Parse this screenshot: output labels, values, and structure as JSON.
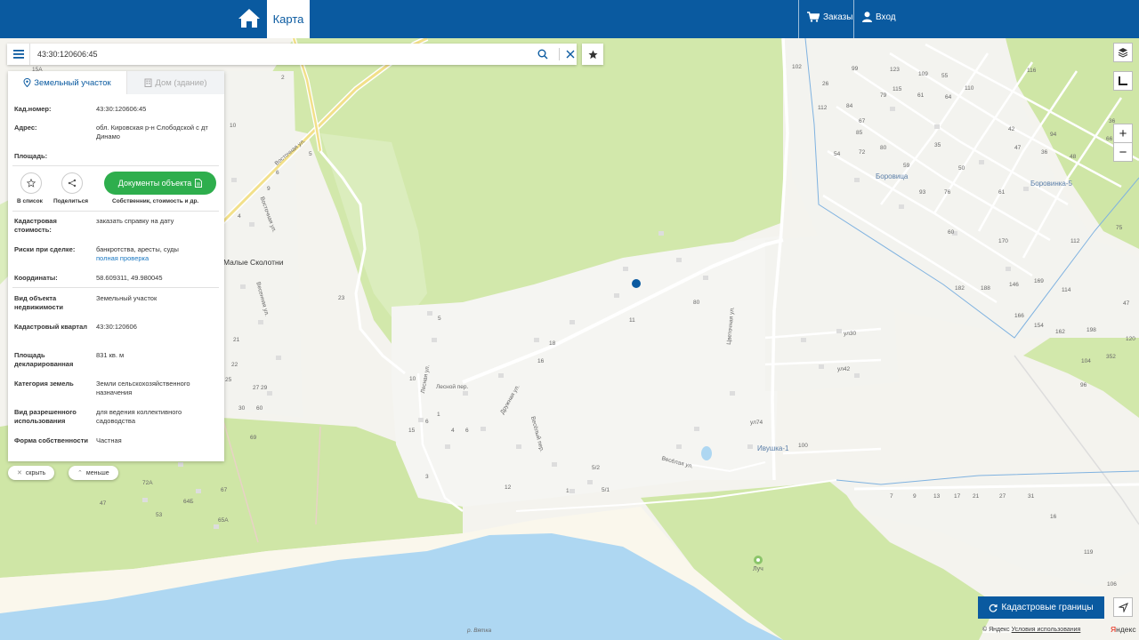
{
  "topbar": {
    "tab_map": "Карта",
    "orders": "Заказы",
    "login": "Вход"
  },
  "search": {
    "value": "43:30:120606:45"
  },
  "panel": {
    "tab_land": "Земельный участок",
    "tab_house": "Дом (здание)",
    "cad_number_label": "Кад.номер:",
    "cad_number": "43:30:120606:45",
    "address_label": "Адрес:",
    "address": "обл. Кировская р-н Слободской с дт Динамо",
    "area_label": "Площадь:",
    "to_list": "В список",
    "share": "Поделиться",
    "docs_button": "Документы объекта",
    "docs_sub": "Собственник, стоимость и др.",
    "cad_value_label": "Кадастровая стоимость:",
    "cad_value_link": "заказать справку на дату",
    "risks_label": "Риски при сделке:",
    "risks": "банкротства, аресты, суды",
    "risks_link": "полная проверка",
    "coords_label": "Координаты:",
    "coords": "58.609311, 49.980045",
    "type_label": "Вид объекта недвижимости",
    "type": "Земельный участок",
    "quarter_label": "Кадастровый квартал",
    "quarter": "43:30:120606",
    "declared_area_label": "Площадь декларированная",
    "declared_area": "831 кв. м",
    "category_label": "Категория земель",
    "category": "Земли сельскохозяйственного назначения",
    "permitted_use_label": "Вид разрешенного использования",
    "permitted_use": "для ведения коллективного садоводства",
    "ownership_label": "Форма собственности",
    "ownership": "Частная"
  },
  "panel_controls": {
    "hide": "скрыть",
    "less": "меньше"
  },
  "map": {
    "places": {
      "malye_skolotni": "Малые Сколотни",
      "borovitsa": "Боровица",
      "borovinka": "Боровинка-5",
      "ivushka": "Ивушка-1",
      "luch": "Луч"
    },
    "streets": {
      "vostochnaya": "Восточная ул.",
      "vostochnaya2": "Восточная ул.",
      "vesennaya": "Весенняя ул.",
      "lesnaya": "Лесная ул.",
      "lesnoy_per": "Лесной пер.",
      "druzhnaya": "Дружная ул.",
      "vesely_per": "Весёлый пер.",
      "tsvetochnaya": "Цветочная ул.",
      "veselaya": "Весёлая ул.",
      "u30": "ул30",
      "u42": "ул42",
      "u74": "ул74",
      "river": "р. Вятка"
    },
    "numbers": [
      "15А",
      "2",
      "10",
      "4",
      "23",
      "5",
      "9",
      "6",
      "11",
      "20",
      "21",
      "22",
      "25",
      "27",
      "29",
      "30",
      "60",
      "69",
      "72А",
      "67",
      "64Б",
      "47",
      "53",
      "65А",
      "11",
      "80",
      "18",
      "5",
      "16",
      "10",
      "1",
      "6",
      "15",
      "4",
      "6",
      "12",
      "5/2",
      "5/1",
      "1",
      "3",
      "7",
      "9",
      "13",
      "17",
      "21",
      "27",
      "31",
      "16",
      "119",
      "106",
      "100",
      "102",
      "99",
      "123",
      "109",
      "55",
      "26",
      "115",
      "110",
      "116",
      "112",
      "84",
      "79",
      "61",
      "64",
      "67",
      "85",
      "80",
      "59",
      "35",
      "50",
      "42",
      "54",
      "72",
      "93",
      "76",
      "61",
      "47",
      "36",
      "48",
      "60",
      "170",
      "146",
      "169",
      "114",
      "182",
      "188",
      "166",
      "154",
      "162",
      "198",
      "352",
      "120",
      "104",
      "96",
      "36",
      "75",
      "47",
      "66",
      "94",
      "112"
    ]
  },
  "controls": {
    "cad_boundaries": "Кадастровые границы",
    "copyright": "© Яндекс",
    "terms": "Условия использования",
    "yandex_ya": "Я",
    "yandex_rest": "ндекс"
  },
  "colors": {
    "brand": "#0a5aa0",
    "green_button": "#2eae4d",
    "link": "#1a78c2",
    "forest": "#cfe6a8",
    "water": "#aed7f2"
  }
}
